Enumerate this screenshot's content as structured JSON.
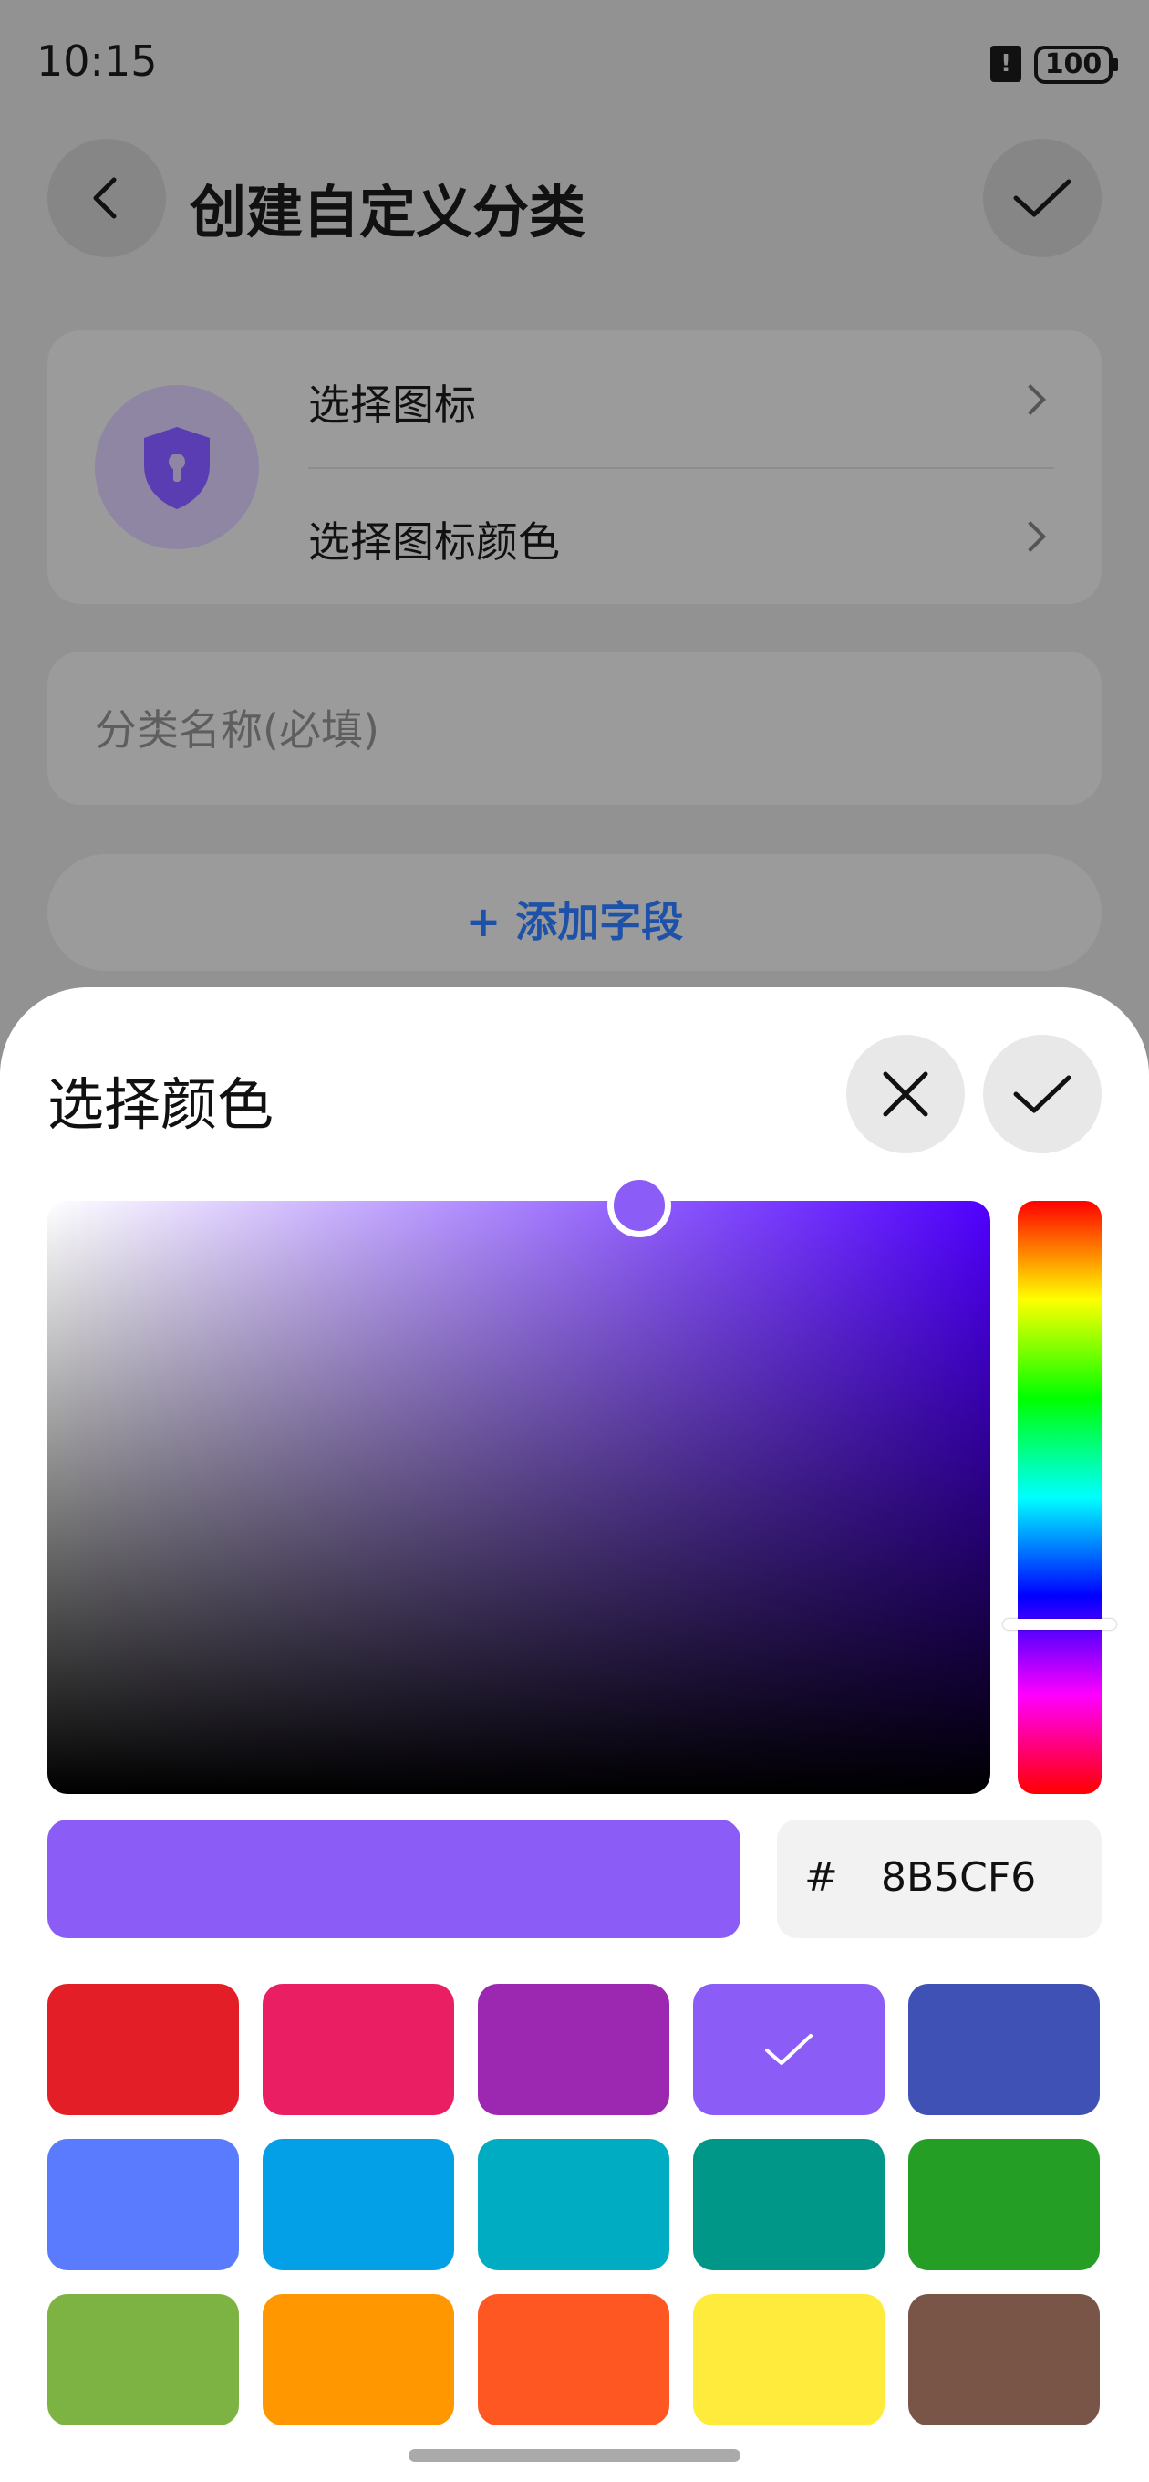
{
  "status": {
    "time": "10:15",
    "battery": "100"
  },
  "header": {
    "title": "创建自定义分类"
  },
  "icon_card": {
    "choose_icon": "选择图标",
    "choose_icon_color": "选择图标颜色"
  },
  "name_field": {
    "placeholder": "分类名称(必填)"
  },
  "add_field": {
    "label": "+ 添加字段"
  },
  "sheet": {
    "title": "选择颜色",
    "hex_prefix": "#",
    "hex_value": "8B5CF6",
    "selected_color": "#8B5CF6"
  },
  "swatches": [
    "#E41E26",
    "#E91E63",
    "#9C27B0",
    "#8B5CF6",
    "#3F51B5",
    "#5A7BFE",
    "#03A0E8",
    "#00ACC1",
    "#009688",
    "#259E26",
    "#7CB342",
    "#FF9800",
    "#FF5722",
    "#FFEB3B",
    "#795548"
  ],
  "selected_swatch_index": 3
}
